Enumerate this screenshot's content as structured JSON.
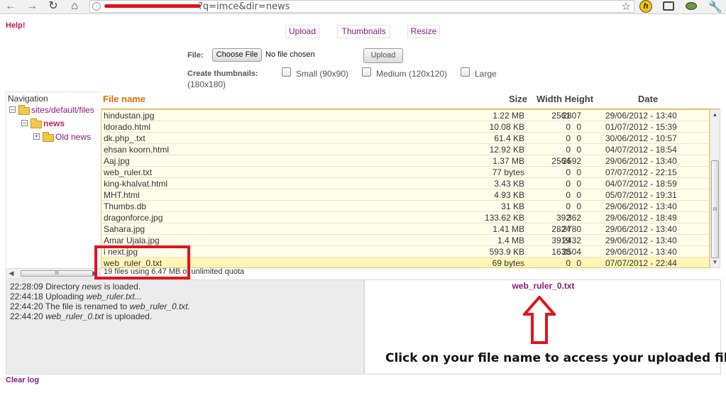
{
  "browser": {
    "url_text": "?q=imce&dir=news",
    "icons": [
      "back-icon",
      "forward-icon",
      "reload-icon",
      "home-icon",
      "globe-icon",
      "star-icon",
      "h-extension-icon",
      "window-extension-icon",
      "eye-extension-icon",
      "wrench-icon"
    ]
  },
  "header": {
    "help": "Help!",
    "tabs": {
      "upload": "Upload",
      "thumbnails": "Thumbnails",
      "resize": "Resize"
    }
  },
  "form": {
    "file_label": "File:",
    "choose_file": "Choose File",
    "no_file": "No file chosen",
    "upload": "Upload",
    "thumb_label": "Create thumbnails:",
    "thumbs": {
      "small": "Small (90x90)",
      "medium": "Medium (120x120)",
      "large": "Large",
      "large_size": "(180x180)"
    }
  },
  "navigation": {
    "title": "Navigation",
    "root": "sites/default/files",
    "current": "news",
    "child": "Old news",
    "scroll_grip": "III"
  },
  "file_list": {
    "headers": {
      "name": "File name",
      "size": "Size",
      "width_height": "Width Height",
      "date": "Date"
    },
    "rows": [
      {
        "name": "hindustan.jpg",
        "size": "1.22 MB",
        "width": "2561",
        "height": "2807",
        "date": "29/06/2012 - 13:40"
      },
      {
        "name": "ldorado.html",
        "size": "10.08 KB",
        "width": "0",
        "height": "0",
        "date": "01/07/2012 - 15:39"
      },
      {
        "name": "dk.php_.txt",
        "size": "61.4 KB",
        "width": "0",
        "height": "0",
        "date": "30/06/2012 - 10:57"
      },
      {
        "name": "ehsan koorn.html",
        "size": "12.92 KB",
        "width": "0",
        "height": "0",
        "date": "04/07/2012 - 18:54"
      },
      {
        "name": "Aaj.jpg",
        "size": "1.37 MB",
        "width": "2564",
        "height": "2592",
        "date": "29/06/2012 - 13:40"
      },
      {
        "name": "web_ruler.txt",
        "size": "77 bytes",
        "width": "0",
        "height": "0",
        "date": "07/07/2012 - 22:15"
      },
      {
        "name": "king-khalvat.html",
        "size": "3.43 KB",
        "width": "0",
        "height": "0",
        "date": "04/07/2012 - 18:59"
      },
      {
        "name": "MHT.html",
        "size": "4.93 KB",
        "width": "0",
        "height": "0",
        "date": "05/07/2012 - 19:31"
      },
      {
        "name": "Thumbs.db",
        "size": "31 KB",
        "width": "0",
        "height": "0",
        "date": "29/06/2012 - 13:40"
      },
      {
        "name": "dragonforce.jpg",
        "size": "133.62 KB",
        "width": "392",
        "height": "362",
        "date": "29/06/2012 - 18:49"
      },
      {
        "name": "Sahara.jpg",
        "size": "1.41 MB",
        "width": "2824",
        "height": "2780",
        "date": "29/06/2012 - 13:40"
      },
      {
        "name": "Amar Ujala.jpg",
        "size": "1.4 MB",
        "width": "3919",
        "height": "2432",
        "date": "29/06/2012 - 13:40"
      },
      {
        "name": "i next.jpg",
        "size": "593.9 KB",
        "width": "1638",
        "height": "2504",
        "date": "29/06/2012 - 13:40"
      },
      {
        "name": "web_ruler_0.txt",
        "size": "69 bytes",
        "width": "0",
        "height": "0",
        "date": "07/07/2012 - 22:44",
        "selected": true
      }
    ],
    "status": "19 files using 6.47 MB of unlimited quota",
    "scroll_grip": "III"
  },
  "log": {
    "lines": [
      {
        "time": "22:28:09",
        "pre": "Directory",
        "em": "news",
        "post": "is loaded."
      },
      {
        "time": "22:44:18",
        "pre": "Uploading",
        "em": "web_ruler.txt...",
        "post": ""
      },
      {
        "time": "22:44:20",
        "pre": "The file is renamed to",
        "em": "web_ruler_0.txt.",
        "post": ""
      },
      {
        "time": "22:44:20",
        "pre": "",
        "em": "web_ruler_0.txt",
        "post": "is uploaded."
      }
    ],
    "clear": "Clear log"
  },
  "preview": {
    "filename": "web_ruler_0.txt"
  },
  "annotation": {
    "text": "Click on your file name to access your uploaded file",
    "color": "#e2141c"
  },
  "colors": {
    "link": "#8b1a7a",
    "header_accent": "#ee6a00",
    "file_row_bg": "#fffeeb",
    "selected_row_bg": "#fff6b8"
  }
}
